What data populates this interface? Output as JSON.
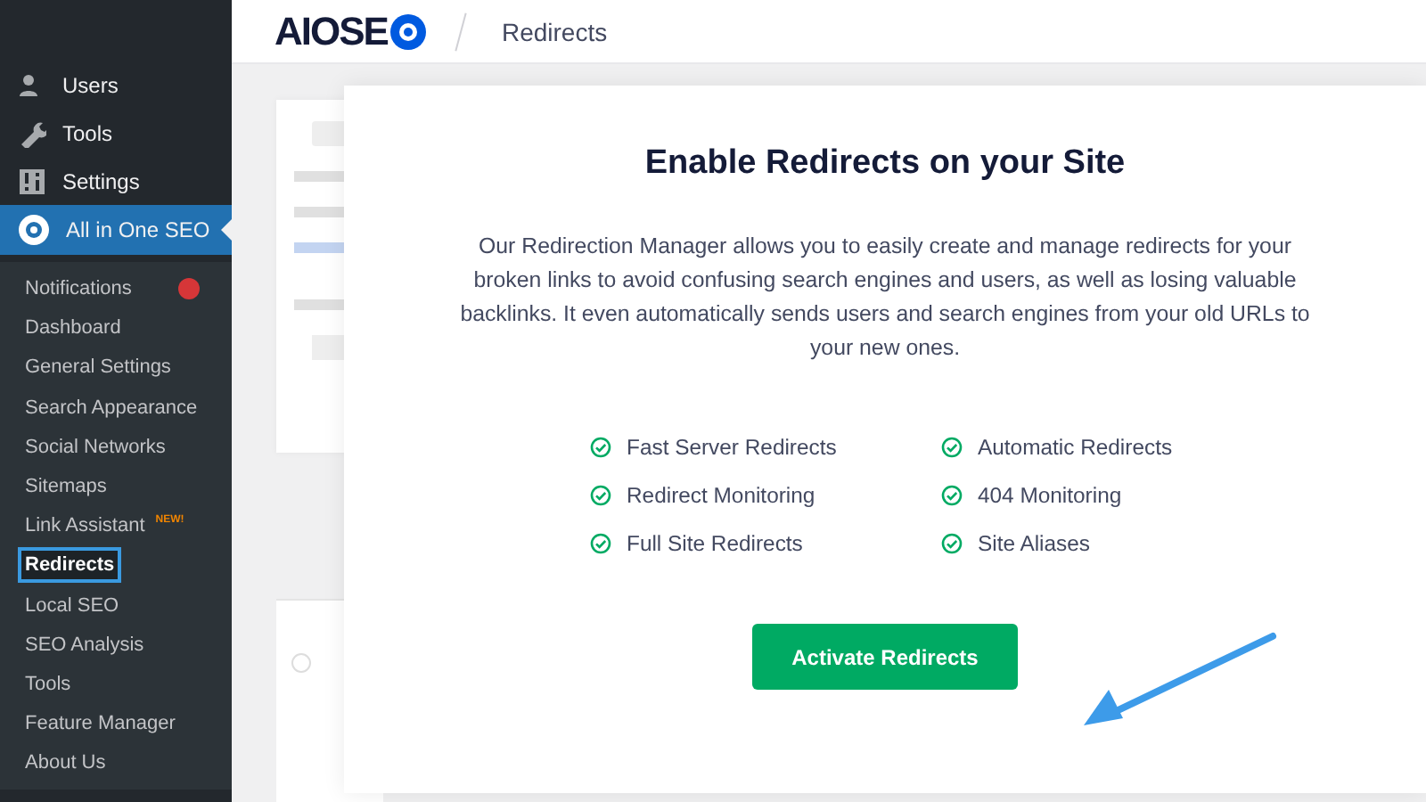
{
  "sidebar": {
    "menu": [
      {
        "label": "Users",
        "selected": false
      },
      {
        "label": "Tools",
        "selected": false
      },
      {
        "label": "Settings",
        "selected": false
      },
      {
        "label": "All in One SEO",
        "selected": true
      }
    ],
    "submenu": [
      {
        "label": "Notifications",
        "selected": false,
        "color": "#d63638"
      },
      {
        "label": "Dashboard",
        "selected": false
      },
      {
        "label": "General Settings",
        "selected": false
      },
      {
        "label": "Search Appearance",
        "selected": false
      },
      {
        "label": "Social Networks",
        "selected": false
      },
      {
        "label": "Sitemaps",
        "selected": false
      },
      {
        "label": "Link Assistant",
        "selected": false,
        "badge": "NEW!"
      },
      {
        "label": "Redirects",
        "selected": true
      },
      {
        "label": "Local SEO",
        "selected": false
      },
      {
        "label": "SEO Analysis",
        "selected": false
      },
      {
        "label": "Tools",
        "selected": false
      },
      {
        "label": "Feature Manager",
        "selected": false
      },
      {
        "label": "About Us",
        "selected": false
      }
    ]
  },
  "header": {
    "logo": "AIOSE",
    "breadcrumb": "Redirects"
  },
  "modal": {
    "title": "Enable Redirects on your Site",
    "description": "Our Redirection Manager allows you to easily create and manage redirects for your broken links to avoid confusing search engines and users, as well as losing valuable backlinks. It even automatically sends users and search engines from your old URLs to your new ones.",
    "features": [
      "Fast Server Redirects",
      "Automatic Redirects",
      "Redirect Monitoring",
      "404 Monitoring",
      "Full Site Redirects",
      "Site Aliases"
    ],
    "button": "Activate Redirects"
  }
}
